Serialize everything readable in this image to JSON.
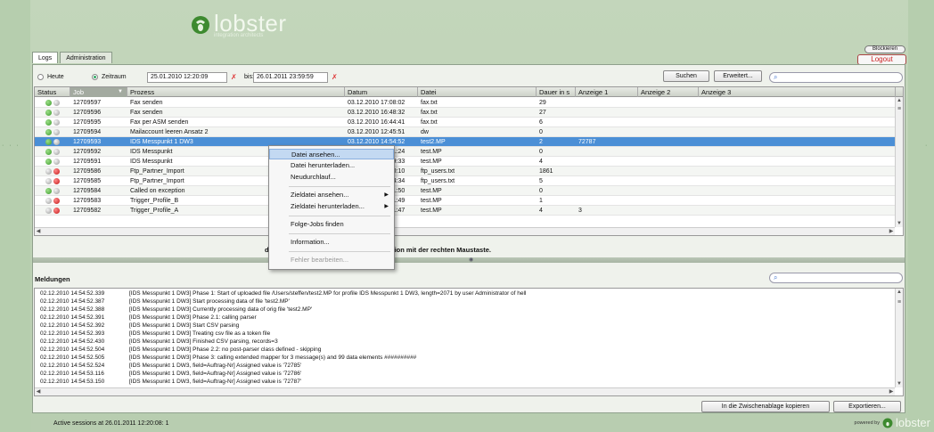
{
  "branding": {
    "logo_text": "lobster",
    "logo_subtext": "integration architects",
    "powered_by": "powered by",
    "powered_logo": "lobster",
    "logo_icon": "lobster-icon"
  },
  "nav": {
    "tabs": [
      {
        "label": "Logs",
        "active": true
      },
      {
        "label": "Administration",
        "active": false
      }
    ],
    "block_label": "Blockieren",
    "logout_label": "Logout"
  },
  "filter": {
    "today_label": "Heute",
    "range_label": "Zeitraum",
    "range_selected": true,
    "from_value": "25.01.2010 12:20:09",
    "to_label": "bis:",
    "to_value": "26.01.2011 23:59:59",
    "search_button": "Suchen",
    "advanced_button": "Erweitert...",
    "search_placeholder": ""
  },
  "jobs_table": {
    "columns": [
      "Status",
      "Job",
      "Prozess",
      "Datum",
      "Datei",
      "Dauer in s",
      "Anzeige 1",
      "Anzeige 2",
      "Anzeige 3"
    ],
    "sorted_column": "Job",
    "rows": [
      {
        "status": [
          "green",
          "grey"
        ],
        "job": "12709597",
        "prozess": "Fax senden",
        "datum": "03.12.2010 17:08:02",
        "datei": "fax.txt",
        "dauer": "29",
        "a1": ""
      },
      {
        "status": [
          "green",
          "grey"
        ],
        "job": "12709596",
        "prozess": "Fax senden",
        "datum": "03.12.2010 16:48:32",
        "datei": "fax.txt",
        "dauer": "27",
        "a1": ""
      },
      {
        "status": [
          "green",
          "grey"
        ],
        "job": "12709595",
        "prozess": "Fax per ASM senden",
        "datum": "03.12.2010 16:44:41",
        "datei": "fax.txt",
        "dauer": "6",
        "a1": ""
      },
      {
        "status": [
          "green",
          "grey"
        ],
        "job": "12709594",
        "prozess": "Mailaccount leeren Ansatz 2",
        "datum": "03.12.2010 12:45:51",
        "datei": "dw",
        "dauer": "0",
        "a1": ""
      },
      {
        "status": [
          "green",
          "grey"
        ],
        "job": "12709593",
        "prozess": "IDS Messpunkt 1 DW3",
        "datum": "03.12.2010 14:54:52",
        "datei": "test2.MP",
        "dauer": "2",
        "a1": "72787",
        "selected": true
      },
      {
        "status": [
          "green",
          "grey"
        ],
        "job": "12709592",
        "prozess": "IDS Messpunkt",
        "datum": "03.12.2010 14:51:24",
        "datei": "test.MP",
        "dauer": "0",
        "a1": ""
      },
      {
        "status": [
          "green",
          "grey"
        ],
        "job": "12709591",
        "prozess": "IDS Messpunkt",
        "datum": "03.12.2010 14:49:33",
        "datei": "test.MP",
        "dauer": "4",
        "a1": ""
      },
      {
        "status": [
          "grey",
          "red"
        ],
        "job": "12709586",
        "prozess": "Ftp_Partner_Import",
        "datum": "03.12.2010 14:40:10",
        "datei": "ftp_users.txt",
        "dauer": "1861",
        "a1": ""
      },
      {
        "status": [
          "grey",
          "red"
        ],
        "job": "12709585",
        "prozess": "Ftp_Partner_Import",
        "datum": "03.12.2010 14:34:34",
        "datei": "ftp_users.txt",
        "dauer": "5",
        "a1": ""
      },
      {
        "status": [
          "green",
          "grey"
        ],
        "job": "12709584",
        "prozess": "Called on exception",
        "datum": "03.12.2010 14:31:50",
        "datei": "test.MP",
        "dauer": "0",
        "a1": ""
      },
      {
        "status": [
          "grey",
          "red"
        ],
        "job": "12709583",
        "prozess": "Trigger_Profile_B",
        "datum": "03.12.2010 14:31:49",
        "datei": "test.MP",
        "dauer": "1",
        "a1": ""
      },
      {
        "status": [
          "grey",
          "red"
        ],
        "job": "12709582",
        "prozess": "Trigger_Profile_A",
        "datum": "03.12.2010 14:31:47",
        "datei": "test.MP",
        "dauer": "4",
        "a1": "3"
      }
    ]
  },
  "hint_text": "der oberen Liste und starten Sie eine Aktion mit der rechten Maustaste.",
  "context_menu": {
    "items": [
      {
        "label": "Datei ansehen...",
        "hover": true
      },
      {
        "label": "Datei herunterladen..."
      },
      {
        "label": "Neudurchlauf..."
      },
      {
        "sep": true
      },
      {
        "label": "Zieldatei ansehen...",
        "submenu": true
      },
      {
        "label": "Zieldatei herunterladen...",
        "submenu": true
      },
      {
        "sep": true
      },
      {
        "label": "Folge-Jobs finden"
      },
      {
        "sep": true
      },
      {
        "label": "Information..."
      },
      {
        "sep": true
      },
      {
        "label": "Fehler bearbeiten...",
        "disabled": true
      }
    ]
  },
  "messages": {
    "title": "Meldungen",
    "search_placeholder": "",
    "rows": [
      {
        "ts": "02.12.2010 14:54:52.339",
        "text": "[IDS Messpunkt 1 DW3] Phase 1: Start of uploaded file /Users/steffen/test2.MP for profile IDS Messpunkt 1 DW3, length=2071 by user Administrator of hell"
      },
      {
        "ts": "02.12.2010 14:54:52.387",
        "text": "[IDS Messpunkt 1 DW3] Start processing data of file 'test2.MP'"
      },
      {
        "ts": "02.12.2010 14:54:52.388",
        "text": "[IDS Messpunkt 1 DW3] Currently processing data of orig file 'test2.MP'"
      },
      {
        "ts": "02.12.2010 14:54:52.391",
        "text": "[IDS Messpunkt 1 DW3] Phase 2.1: calling parser"
      },
      {
        "ts": "02.12.2010 14:54:52.392",
        "text": "[IDS Messpunkt 1 DW3] Start CSV parsing"
      },
      {
        "ts": "02.12.2010 14:54:52.393",
        "text": "[IDS Messpunkt 1 DW3] Treating csv file as a token file"
      },
      {
        "ts": "02.12.2010 14:54:52.430",
        "text": "[IDS Messpunkt 1 DW3] Finished CSV parsing, records=3"
      },
      {
        "ts": "02.12.2010 14:54:52.504",
        "text": "[IDS Messpunkt 1 DW3] Phase 2.2: no post-parser class defined - skipping"
      },
      {
        "ts": "02.12.2010 14:54:52.505",
        "text": "[IDS Messpunkt 1 DW3] Phase 3: calling extended mapper for 3 message(s) and 99 data elements ##########"
      },
      {
        "ts": "02.12.2010 14:54:52.524",
        "text": "[IDS Messpunkt 1 DW3, field=Auftrag-Nr] Assigned value is '72785'"
      },
      {
        "ts": "02.12.2010 14:54:53.116",
        "text": "[IDS Messpunkt 1 DW3, field=Auftrag-Nr] Assigned value is '72786'"
      },
      {
        "ts": "02.12.2010 14:54:53.150",
        "text": "[IDS Messpunkt 1 DW3, field=Auftrag-Nr] Assigned value is '72787'"
      }
    ],
    "copy_button": "In die Zwischenablage kopieren",
    "export_button": "Exportieren..."
  },
  "status_bar": {
    "sessions_text": "Active sessions at 26.01.2011 12:20:08: 1"
  }
}
